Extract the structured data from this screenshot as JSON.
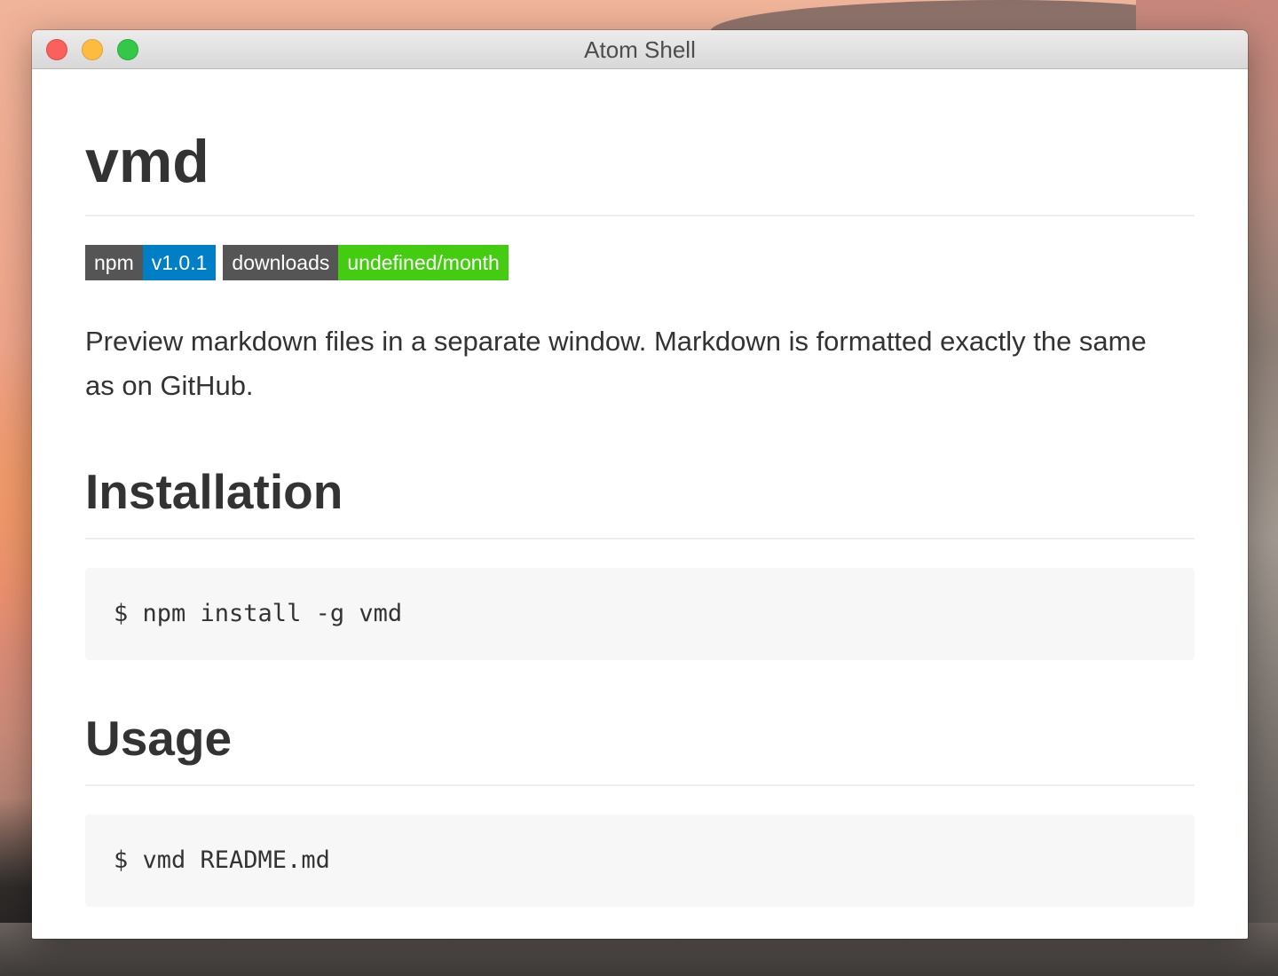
{
  "window": {
    "title": "Atom Shell"
  },
  "document": {
    "heading": "vmd",
    "badges": [
      {
        "label": "npm",
        "value": "v1.0.1",
        "value_color": "#007ec6"
      },
      {
        "label": "downloads",
        "value": "undefined/month",
        "value_color": "#44cc11"
      }
    ],
    "description": "Preview markdown files in a separate window. Markdown is formatted exactly the same as on GitHub.",
    "sections": [
      {
        "heading": "Installation",
        "code": "$ npm install -g vmd"
      },
      {
        "heading": "Usage",
        "code": "$ vmd README.md"
      }
    ]
  },
  "icons": {
    "close": "close-traffic-light",
    "minimize": "minimize-traffic-light",
    "zoom": "zoom-traffic-light"
  },
  "colors": {
    "close": "#fc605c",
    "minimize": "#fdbc40",
    "zoom": "#34c84a",
    "text": "#333333",
    "code_background": "#f7f7f7"
  }
}
